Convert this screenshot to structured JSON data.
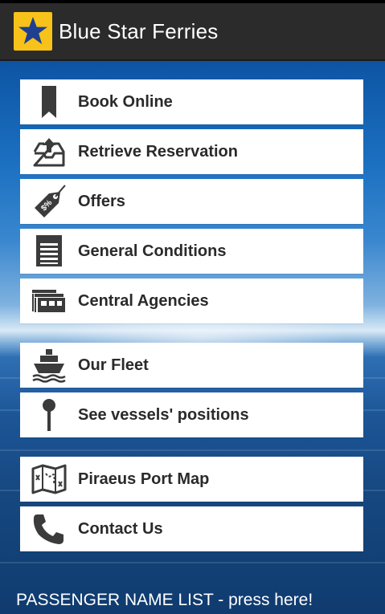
{
  "app": {
    "title": "Blue Star Ferries",
    "logo_icon": "star-logo-icon",
    "brand_colors": {
      "logo_bg": "#f7c21a",
      "star": "#1f3f8f"
    }
  },
  "menu": {
    "items": [
      {
        "label": "Book Online",
        "icon": "bookmark-icon"
      },
      {
        "label": "Retrieve Reservation",
        "icon": "inbox-upload-icon"
      },
      {
        "label": "Offers",
        "icon": "price-tag-icon"
      },
      {
        "label": "General Conditions",
        "icon": "document-list-icon"
      },
      {
        "label": "Central Agencies",
        "icon": "agency-building-icon"
      },
      {
        "label": "Our Fleet",
        "icon": "ship-icon"
      },
      {
        "label": "See vessels' positions",
        "icon": "map-pin-icon"
      },
      {
        "label": "Piraeus Port Map",
        "icon": "folded-map-icon"
      },
      {
        "label": "Contact Us",
        "icon": "phone-handset-icon"
      }
    ]
  },
  "footer": {
    "link_text": "PASSENGER NAME LIST - press here!"
  }
}
